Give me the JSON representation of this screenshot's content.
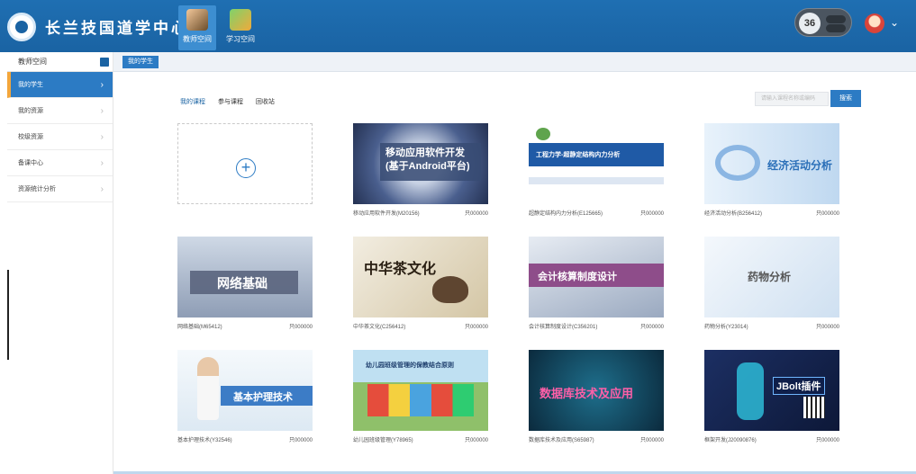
{
  "header": {
    "brand": "长兰技国道学中心",
    "nav_tabs": [
      {
        "label": "教师空间",
        "icon": "teacher-icon"
      },
      {
        "label": "学习空间",
        "icon": "learning-icon"
      }
    ],
    "timer_value": "36"
  },
  "sidebar": {
    "title": "教师空间",
    "items": [
      {
        "label": "我的学生",
        "active": true
      },
      {
        "label": "我的资源",
        "active": false
      },
      {
        "label": "校级资源",
        "active": false
      },
      {
        "label": "备课中心",
        "active": false
      },
      {
        "label": "资源统计分析",
        "active": false
      }
    ]
  },
  "breadcrumb": "我的学生",
  "tabs": [
    "我的课程",
    "参与课程",
    "回收站"
  ],
  "search": {
    "placeholder": "请输入课程名称或编码",
    "button": "搜索"
  },
  "courses": [
    {
      "name": "移动应用软件开发(M20156)",
      "price": "只000000",
      "banner": "移动应用软件开发 (基于Android平台)"
    },
    {
      "name": "超静定结构内力分析(E125665)",
      "price": "只000000",
      "banner": "工程力学-超静定结构内力分析"
    },
    {
      "name": "经济活动分析(B256412)",
      "price": "只000000",
      "banner": "经济活动分析"
    },
    {
      "name": "网络基础(M65412)",
      "price": "只000000",
      "banner": "网络基础"
    },
    {
      "name": "中华茶文化(C256412)",
      "price": "只000000",
      "banner": "中华茶文化"
    },
    {
      "name": "会计核算制度设计(C356201)",
      "price": "只000000",
      "banner": "会计核算制度设计"
    },
    {
      "name": "药物分析(Y23014)",
      "price": "只000000",
      "banner": "药物分析"
    },
    {
      "name": "基本护理技术(Y32546)",
      "price": "只000000",
      "banner": "基本护理技术"
    },
    {
      "name": "幼儿园班级管理(Y78965)",
      "price": "只000000",
      "banner": "幼儿园班级管理的保教结合原则"
    },
    {
      "name": "数据库技术及应用(S65987)",
      "price": "只000000",
      "banner": "数据库技术及应用"
    },
    {
      "name": "框架开发(J20090876)",
      "price": "只000000",
      "banner": "JBolt插件"
    }
  ]
}
